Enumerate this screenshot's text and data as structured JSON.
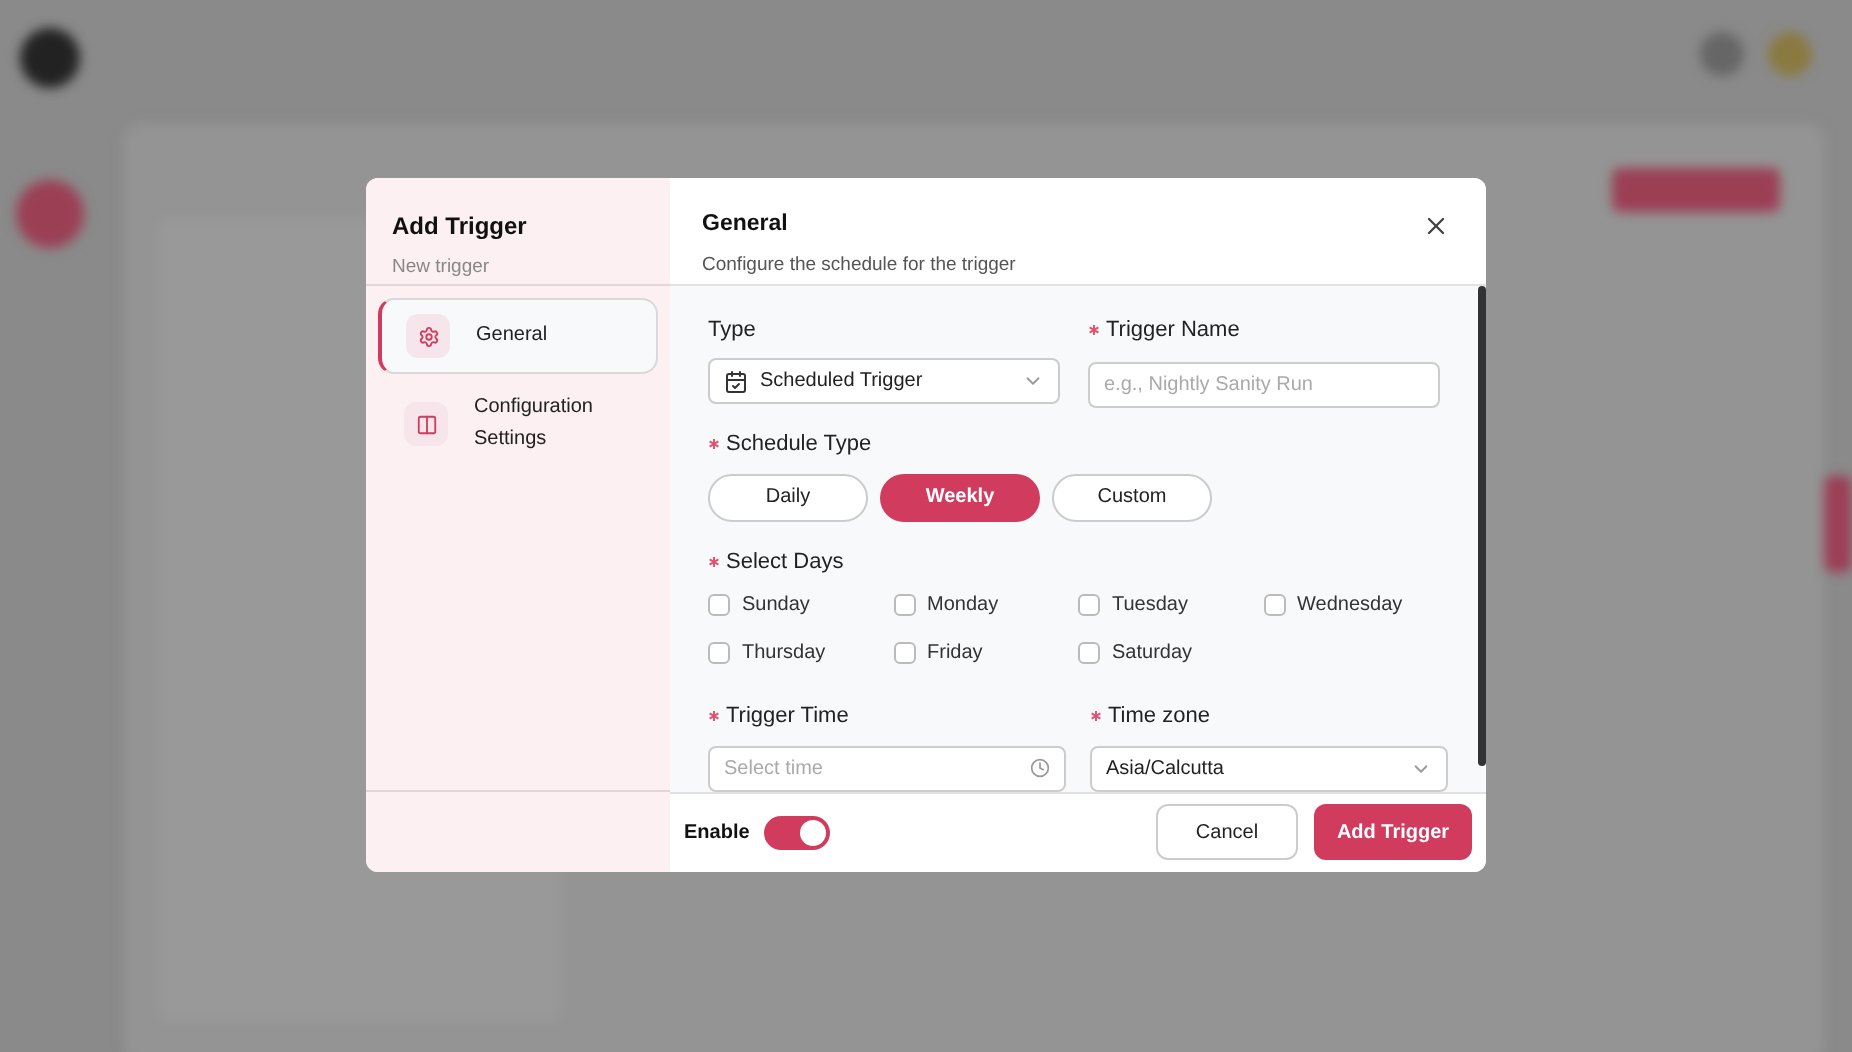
{
  "dialog": {
    "sidebar": {
      "title": "Add Trigger",
      "subtitle": "New trigger",
      "items": [
        {
          "label": "General",
          "selected": true
        },
        {
          "label": "Configuration Settings",
          "selected": false
        }
      ]
    },
    "header": {
      "title": "General",
      "subtitle": "Configure the schedule for the trigger"
    },
    "form": {
      "type": {
        "label": "Type",
        "value": "Scheduled Trigger"
      },
      "trigger_name": {
        "label": "Trigger Name",
        "required": true,
        "placeholder": "e.g., Nightly Sanity Run"
      },
      "schedule_type": {
        "label": "Schedule Type",
        "required": true,
        "options": [
          {
            "label": "Daily",
            "selected": false
          },
          {
            "label": "Weekly",
            "selected": true
          },
          {
            "label": "Custom",
            "selected": false
          }
        ]
      },
      "select_days": {
        "label": "Select Days",
        "required": true,
        "days": [
          {
            "label": "Sunday",
            "checked": false
          },
          {
            "label": "Monday",
            "checked": false
          },
          {
            "label": "Tuesday",
            "checked": false
          },
          {
            "label": "Wednesday",
            "checked": false
          },
          {
            "label": "Thursday",
            "checked": false
          },
          {
            "label": "Friday",
            "checked": false
          },
          {
            "label": "Saturday",
            "checked": false
          }
        ]
      },
      "trigger_time": {
        "label": "Trigger Time",
        "required": true,
        "placeholder": "Select time"
      },
      "time_zone": {
        "label": "Time zone",
        "required": true,
        "value": "Asia/Calcutta"
      }
    },
    "footer": {
      "enable": {
        "label": "Enable",
        "on": true
      },
      "buttons": [
        "Cancel",
        "Add Trigger"
      ]
    }
  }
}
